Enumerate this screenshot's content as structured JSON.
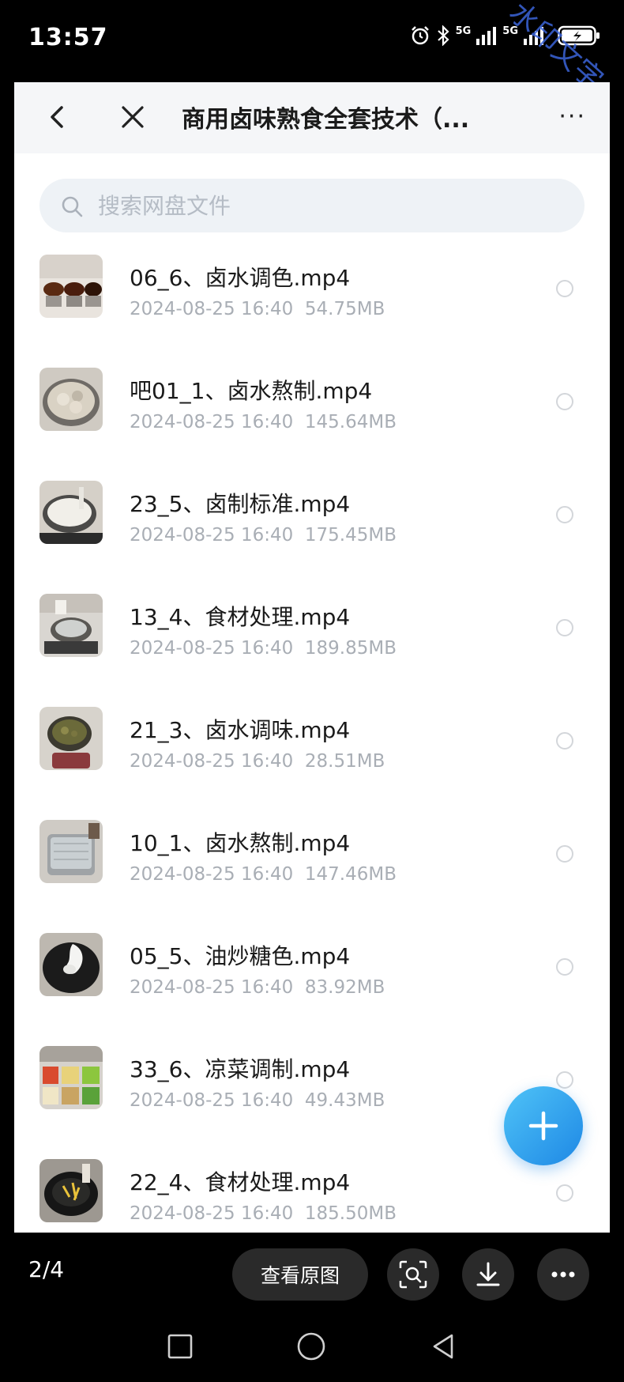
{
  "status_bar": {
    "time": "13:57",
    "net_label_1": "5G",
    "net_label_2": "5G",
    "watermark": "水印文字"
  },
  "nav": {
    "title": "商用卤味熟食全套技术（...",
    "more": "···"
  },
  "search": {
    "placeholder": "搜索网盘文件"
  },
  "files": [
    {
      "name": "06_6、卤水调色.mp4",
      "date": "2024-08-25",
      "time": "16:40",
      "size": "54.75MB"
    },
    {
      "name": "吧01_1、卤水熬制.mp4",
      "date": "2024-08-25",
      "time": "16:40",
      "size": "145.64MB"
    },
    {
      "name": "23_5、卤制标准.mp4",
      "date": "2024-08-25",
      "time": "16:40",
      "size": "175.45MB"
    },
    {
      "name": "13_4、食材处理.mp4",
      "date": "2024-08-25",
      "time": "16:40",
      "size": "189.85MB"
    },
    {
      "name": "21_3、卤水调味.mp4",
      "date": "2024-08-25",
      "time": "16:40",
      "size": "28.51MB"
    },
    {
      "name": "10_1、卤水熬制.mp4",
      "date": "2024-08-25",
      "time": "16:40",
      "size": "147.46MB"
    },
    {
      "name": "05_5、油炒糖色.mp4",
      "date": "2024-08-25",
      "time": "16:40",
      "size": "83.92MB"
    },
    {
      "name": "33_6、凉菜调制.mp4",
      "date": "2024-08-25",
      "time": "16:40",
      "size": "49.43MB"
    },
    {
      "name": "22_4、食材处理.mp4",
      "date": "2024-08-25",
      "time": "16:40",
      "size": "185.50MB"
    }
  ],
  "viewer": {
    "page_counter": "2/4",
    "view_original_label": "查看原图"
  }
}
